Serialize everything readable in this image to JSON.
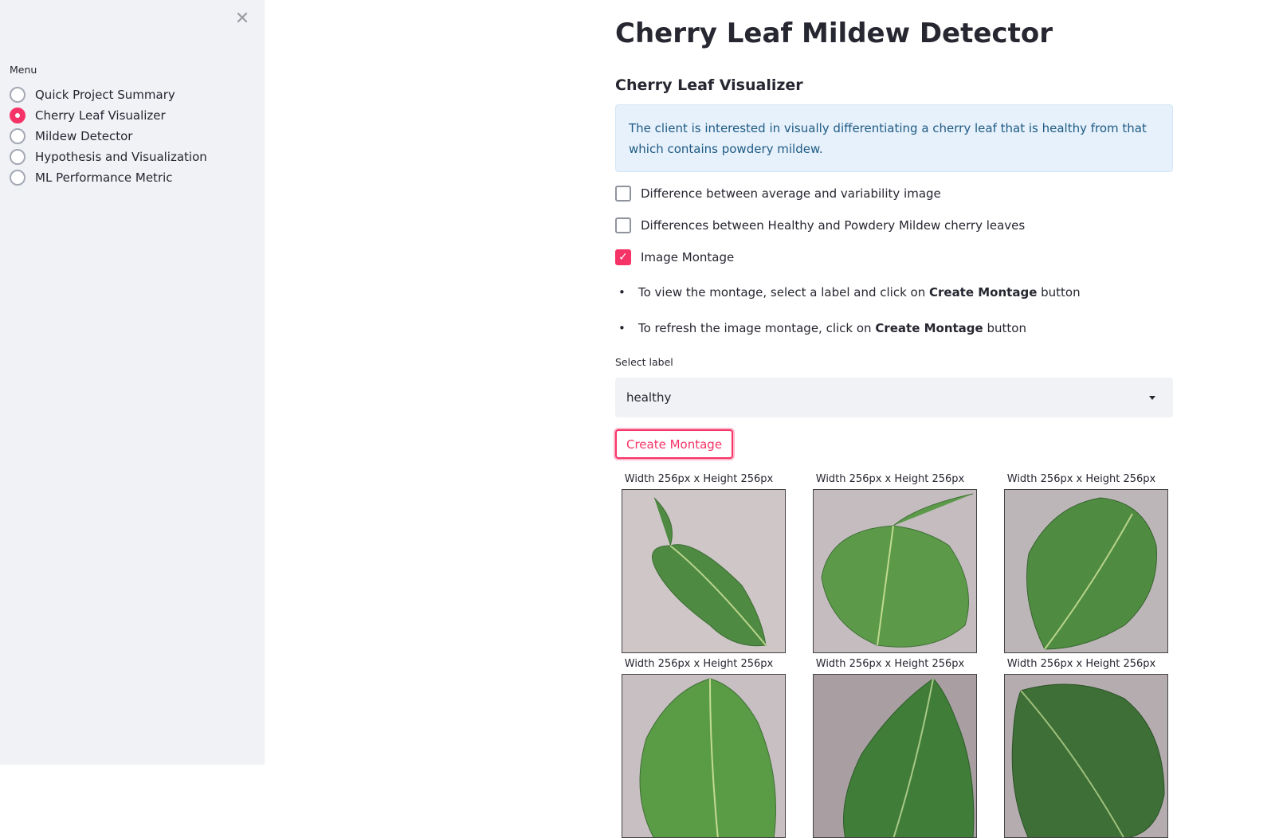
{
  "sidebar": {
    "close_icon": "close-icon",
    "menu_label": "Menu",
    "items": [
      {
        "label": "Quick Project Summary",
        "selected": false
      },
      {
        "label": "Cherry Leaf Visualizer",
        "selected": true
      },
      {
        "label": "Mildew Detector",
        "selected": false
      },
      {
        "label": "Hypothesis and Visualization",
        "selected": false
      },
      {
        "label": "ML Performance Metric",
        "selected": false
      }
    ]
  },
  "main": {
    "title": "Cherry Leaf Mildew Detector",
    "subheader": "Cherry Leaf Visualizer",
    "info": "The client is interested in visually differentiating a cherry leaf that is healthy from that which contains powdery mildew.",
    "checkboxes": [
      {
        "label": "Difference between average and variability image",
        "checked": false
      },
      {
        "label": "Differences between Healthy and Powdery Mildew cherry leaves",
        "checked": false
      },
      {
        "label": "Image Montage",
        "checked": true
      }
    ],
    "bullets": [
      {
        "before": "To view the montage, select a label and click on ",
        "bold": "Create Montage",
        "after": " button"
      },
      {
        "before": "To refresh the image montage, click on ",
        "bold": "Create Montage",
        "after": " button"
      }
    ],
    "select": {
      "label": "Select label",
      "value": "healthy"
    },
    "button_label": "Create Montage",
    "montage": {
      "captions": [
        "Width 256px x Height 256px",
        "Width 256px x Height 256px",
        "Width 256px x Height 256px",
        "Width 256px x Height 256px",
        "Width 256px x Height 256px",
        "Width 256px x Height 256px"
      ]
    }
  },
  "colors": {
    "accent": "#f63366",
    "sidebar_bg": "#f0f2f6",
    "info_bg": "#e6f1fb",
    "info_text": "#205b85",
    "leaf": "#5a9a4a"
  }
}
